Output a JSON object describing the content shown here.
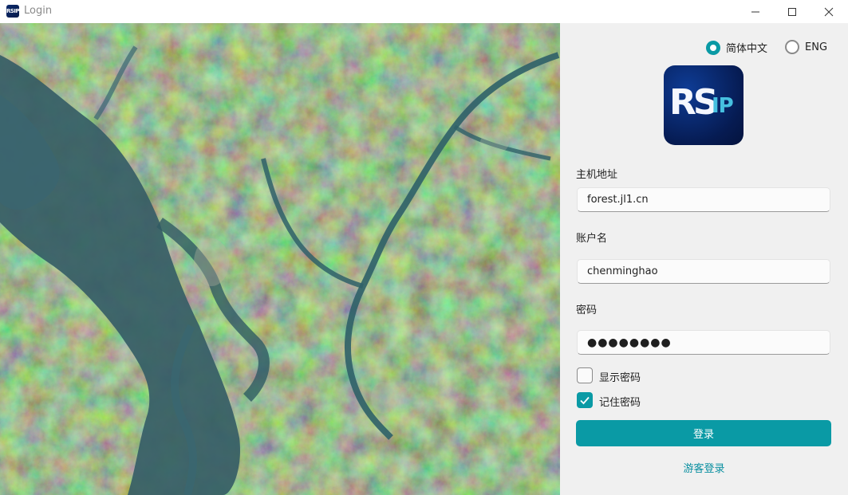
{
  "window": {
    "title": "Login",
    "icon": "rsip-app-icon",
    "icon_text": "RSIP"
  },
  "language": {
    "options": [
      {
        "label": "简体中文",
        "selected": true
      },
      {
        "label": "ENG",
        "selected": false
      }
    ]
  },
  "logo": {
    "rs": "RS",
    "ip": "IP"
  },
  "form": {
    "host_label": "主机地址",
    "host_value": "forest.jl1.cn",
    "account_label": "账户名",
    "account_value": "chenminghao",
    "password_label": "密码",
    "password_value": "●●●●●●●●",
    "show_password_label": "显示密码",
    "show_password_checked": false,
    "remember_password_label": "记住密码",
    "remember_password_checked": true,
    "login_button": "登录",
    "guest_login": "游客登录"
  },
  "colors": {
    "accent": "#0a9aa5",
    "panel_bg": "#f0f0f0"
  }
}
